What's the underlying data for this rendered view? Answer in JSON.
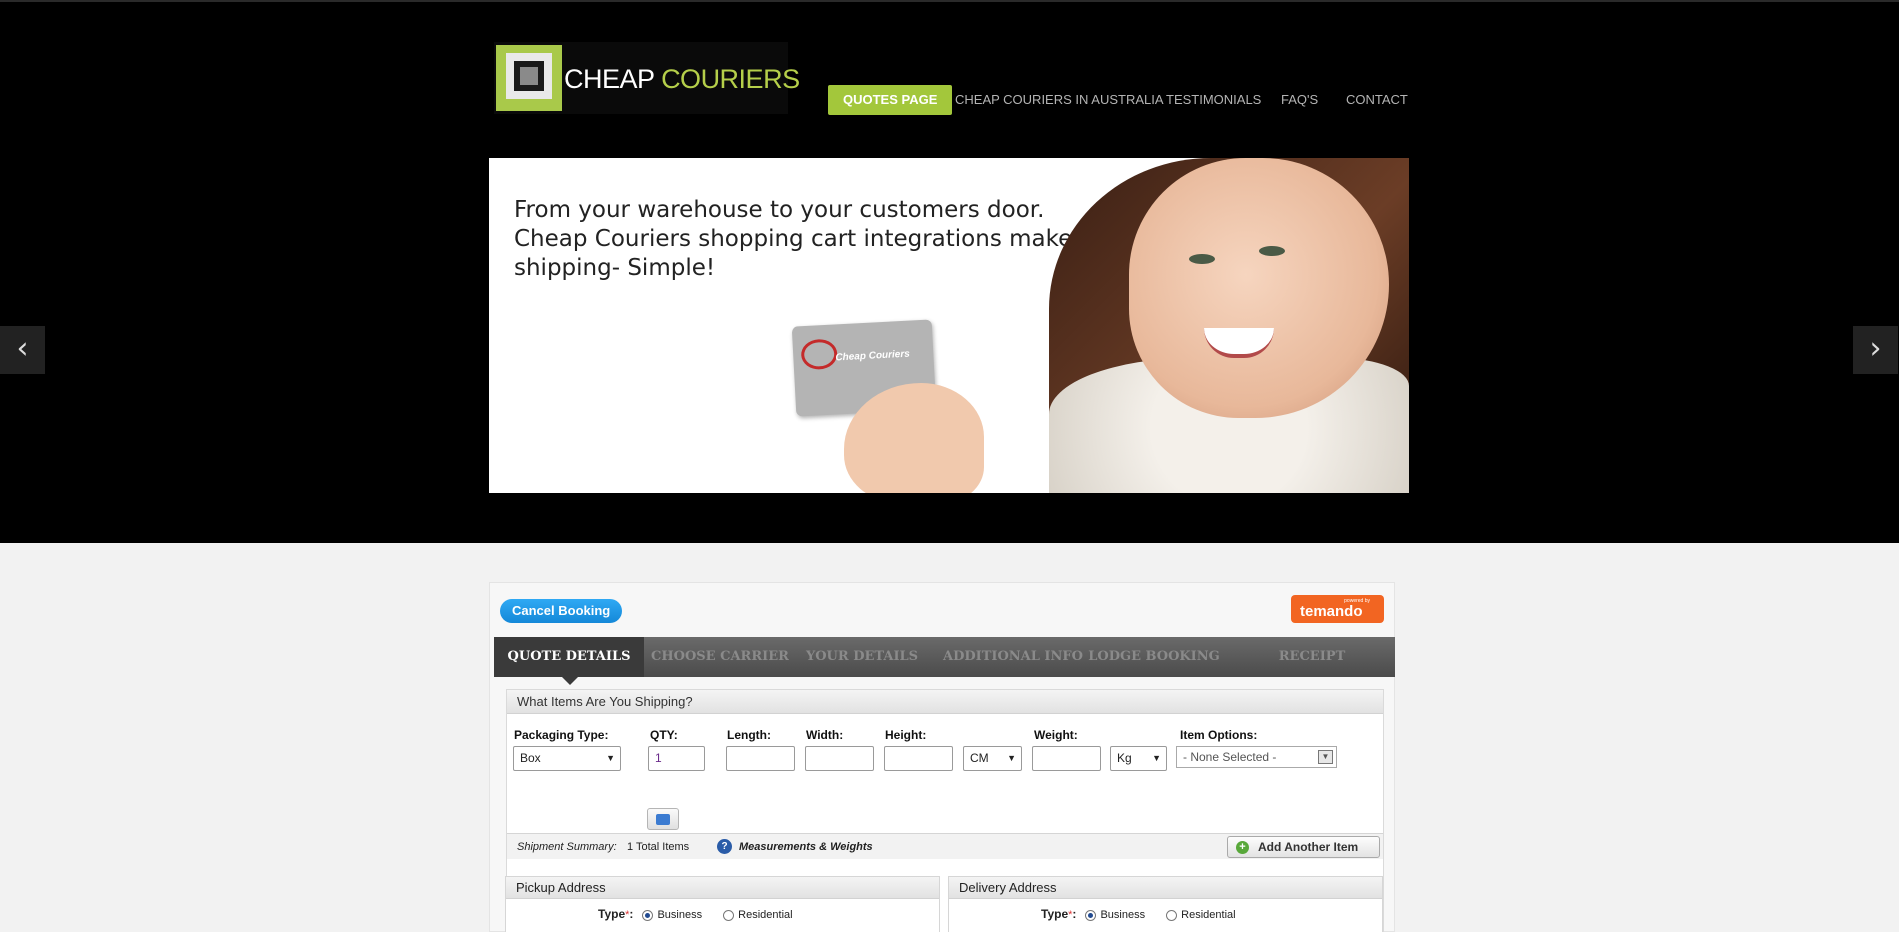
{
  "header": {
    "logo": {
      "word1": "CHEAP",
      "word2": "COURIERS"
    },
    "nav": [
      {
        "label": "QUOTES PAGE",
        "active": true
      },
      {
        "label": "CHEAP COURIERS IN AUSTRALIA",
        "active": false
      },
      {
        "label": "TESTIMONIALS",
        "active": false
      },
      {
        "label": "FAQ'S",
        "active": false
      },
      {
        "label": "CONTACT",
        "active": false
      }
    ]
  },
  "slider": {
    "lines": [
      "From your warehouse to your customers door.",
      "Cheap Couriers shopping cart integrations makes",
      "shipping- Simple!"
    ],
    "card_label": "Cheap Couriers",
    "prev_icon": "‹",
    "next_icon": "›"
  },
  "booking": {
    "cancel_label": "Cancel Booking",
    "temando": {
      "powered_by": "powered by",
      "name": "temando"
    },
    "steps": [
      {
        "label": "QUOTE DETAILS",
        "active": true
      },
      {
        "label": "CHOOSE CARRIER",
        "active": false
      },
      {
        "label": "YOUR DETAILS",
        "active": false
      },
      {
        "label": "ADDITIONAL INFO",
        "active": false
      },
      {
        "label": "LODGE BOOKING",
        "active": false
      },
      {
        "label": "RECEIPT",
        "active": false
      }
    ],
    "items": {
      "title": "What Items Are You Shipping?",
      "labels": {
        "packaging": "Packaging Type:",
        "qty": "QTY:",
        "length": "Length:",
        "width": "Width:",
        "height": "Height:",
        "weight": "Weight:",
        "options": "Item Options:"
      },
      "packaging_value": "Box",
      "qty_value": "1",
      "length_value": "",
      "width_value": "",
      "height_value": "",
      "dim_unit": "CM",
      "weight_value": "",
      "weight_unit": "Kg",
      "options_value": "- None Selected -"
    },
    "summary": {
      "label": "Shipment Summary:",
      "count": "1 Total Items",
      "link": "Measurements & Weights",
      "add_another": "Add Another Item"
    },
    "pickup": {
      "title": "Pickup Address",
      "type_label": "Type",
      "required": "*",
      "colon": ":",
      "opt1": "Business",
      "opt2": "Residential",
      "selected": "Business"
    },
    "delivery": {
      "title": "Delivery Address",
      "type_label": "Type",
      "required": "*",
      "colon": ":",
      "opt1": "Business",
      "opt2": "Residential",
      "selected": "Business"
    }
  },
  "colors": {
    "accent_green": "#a3c73b",
    "cancel_blue": "#1e9be8",
    "temando_orange": "#f26522"
  }
}
